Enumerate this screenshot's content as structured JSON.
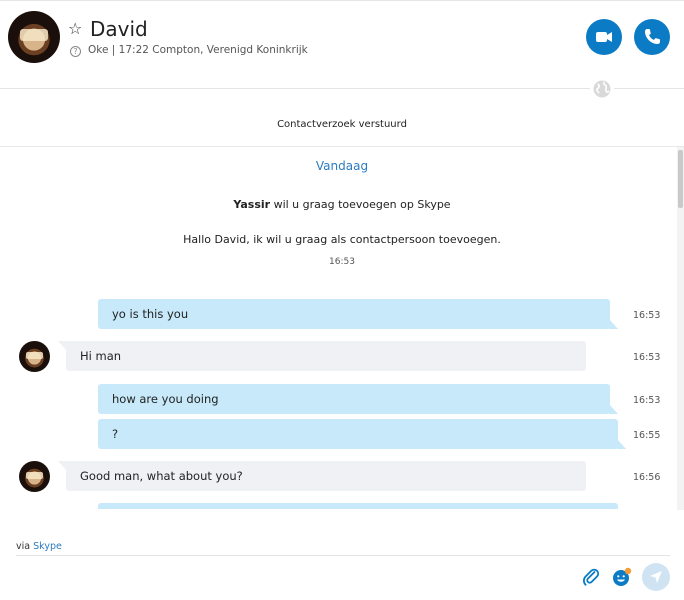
{
  "contact": {
    "name": "David",
    "status": "Oke",
    "separator": "|",
    "local_time_location": "17:22 Compton, Verenigd Koninkrijk"
  },
  "header": {
    "favorite_icon": "star-outline-icon",
    "video_icon": "video-camera-icon",
    "call_icon": "phone-icon",
    "accent_color": "#0a7bc4"
  },
  "conversation": {
    "request_sent": "Contactverzoek verstuurd",
    "day_label": "Vandaag",
    "add_request": {
      "sender": "Yassir",
      "text": " wil u graag toevoegen op Skype",
      "message": "Hallo David, ik wil u graag als contactpersoon toevoegen.",
      "time": "16:53"
    },
    "messages": [
      {
        "direction": "out",
        "text": "yo is this you",
        "time": "16:53"
      },
      {
        "direction": "in",
        "text": "Hi man",
        "time": "16:53"
      },
      {
        "direction": "out",
        "text": "how are you doing",
        "time": "16:53"
      },
      {
        "direction": "out",
        "text": "?",
        "time": "16:55"
      },
      {
        "direction": "in",
        "text": "Good man, what about you?",
        "time": "16:56"
      }
    ]
  },
  "composer": {
    "via_prefix": "via",
    "via_link": "Skype",
    "placeholder": "",
    "attach_icon": "paperclip-icon",
    "emoji_icon": "emoji-icon",
    "send_icon": "send-icon"
  },
  "colors": {
    "outgoing_bubble": "#c7e9f9",
    "incoming_bubble": "#f0f1f5",
    "link": "#2b7bc0"
  }
}
